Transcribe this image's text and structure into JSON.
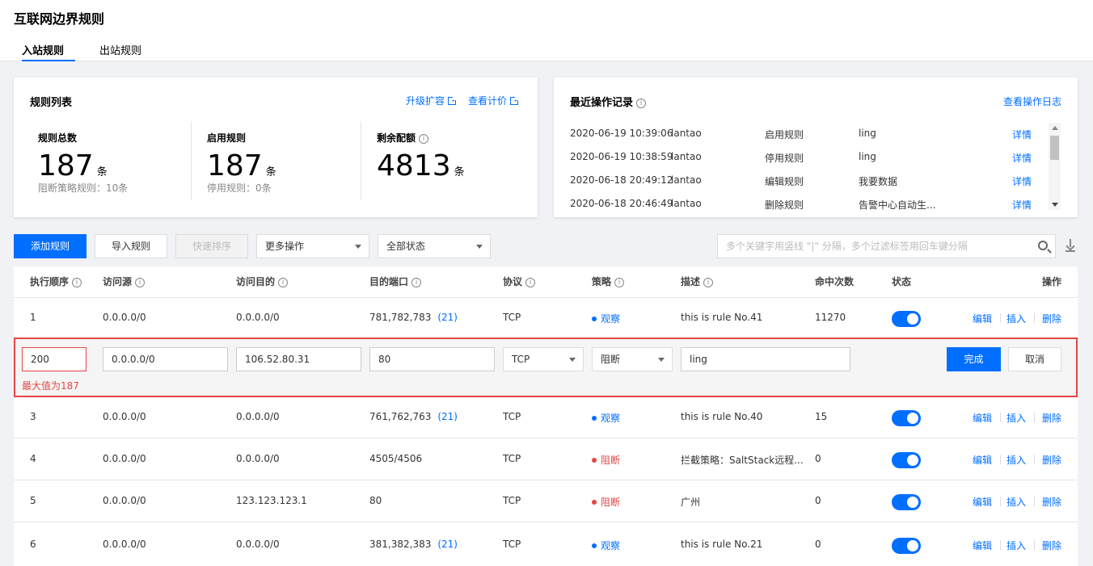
{
  "page": {
    "title": "互联网边界规则",
    "tabs": [
      {
        "label": "入站规则",
        "active": true
      },
      {
        "label": "出站规则",
        "active": false
      }
    ]
  },
  "rules_card": {
    "title": "规则列表",
    "links": [
      "升级扩容",
      "查看计价"
    ],
    "stats": [
      {
        "label": "规则总数",
        "value": "187",
        "unit": "条",
        "sub": "阻断策略规则：10条"
      },
      {
        "label": "启用规则",
        "value": "187",
        "unit": "条",
        "sub": "停用规则：0条"
      },
      {
        "label": "剩余配额",
        "value": "4813",
        "unit": "条",
        "sub": ""
      }
    ]
  },
  "log_card": {
    "title": "最近操作记录",
    "link": "查看操作日志",
    "detail_label": "详情",
    "rows": [
      {
        "time": "2020-06-19 10:39:06",
        "user": "lantao",
        "action": "启用规则",
        "target": "ling"
      },
      {
        "time": "2020-06-19 10:38:59",
        "user": "lantao",
        "action": "停用规则",
        "target": "ling"
      },
      {
        "time": "2020-06-18 20:49:12",
        "user": "lantao",
        "action": "编辑规则",
        "target": "我要数据"
      },
      {
        "time": "2020-06-18 20:46:49",
        "user": "lantao",
        "action": "删除规则",
        "target": "告警中心自动生..."
      }
    ]
  },
  "toolbar": {
    "add": "添加规则",
    "import": "导入规则",
    "sort": "快速排序",
    "more": "更多操作",
    "status": "全部状态",
    "search_placeholder": "多个关键字用竖线 \"|\" 分隔，多个过滤标签用回车键分隔"
  },
  "table": {
    "headers": [
      "执行顺序",
      "访问源",
      "访问目的",
      "目的端口",
      "协议",
      "策略",
      "描述",
      "命中次数",
      "状态",
      "操作"
    ],
    "ops": [
      "编辑",
      "插入",
      "删除"
    ],
    "rows": [
      {
        "order": "1",
        "src": "0.0.0.0/0",
        "dst": "0.0.0.0/0",
        "port": "781,782,783",
        "count": "(21)",
        "proto": "TCP",
        "policy": "观察",
        "policy_color": "#006eff",
        "desc": "this is rule No.41",
        "hits": "11270",
        "enabled": true
      },
      {
        "order": "3",
        "src": "0.0.0.0/0",
        "dst": "0.0.0.0/0",
        "port": "761,762,763",
        "count": "(21)",
        "proto": "TCP",
        "policy": "观察",
        "policy_color": "#006eff",
        "desc": "this is rule No.40",
        "hits": "15",
        "enabled": true
      },
      {
        "order": "4",
        "src": "0.0.0.0/0",
        "dst": "0.0.0.0/0",
        "port": "4505/4506",
        "count": "",
        "proto": "TCP",
        "policy": "阻断",
        "policy_color": "#e54545",
        "desc": "拦截策略：SaltStack远程...",
        "hits": "0",
        "enabled": true
      },
      {
        "order": "5",
        "src": "0.0.0.0/0",
        "dst": "123.123.123.1",
        "port": "80",
        "count": "",
        "proto": "TCP",
        "policy": "阻断",
        "policy_color": "#e54545",
        "desc": "广州",
        "hits": "0",
        "enabled": true
      },
      {
        "order": "6",
        "src": "0.0.0.0/0",
        "dst": "0.0.0.0/0",
        "port": "381,382,383",
        "count": "(21)",
        "proto": "TCP",
        "policy": "观察",
        "policy_color": "#006eff",
        "desc": "this is rule No.21",
        "hits": "0",
        "enabled": true
      }
    ],
    "edit_row": {
      "order": "200",
      "src": "0.0.0.0/0",
      "dst": "106.52.80.31",
      "port": "80",
      "proto": "TCP",
      "policy": "阻断",
      "desc": "ling",
      "error": "最大值为187",
      "done": "完成",
      "cancel": "取消"
    }
  }
}
